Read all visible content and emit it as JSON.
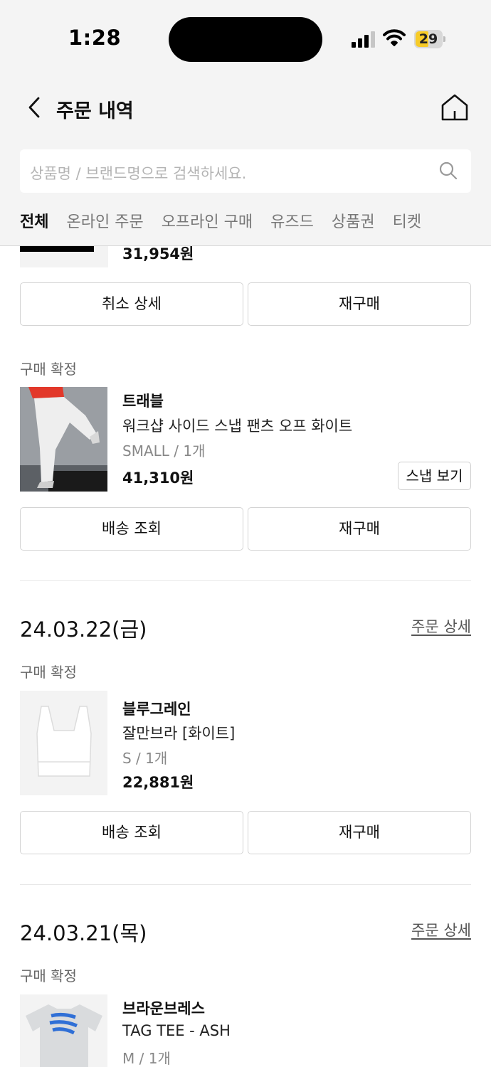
{
  "status_bar": {
    "time": "1:28",
    "battery": "29"
  },
  "header": {
    "title": "주문 내역"
  },
  "search": {
    "placeholder": "상품명 / 브랜드명으로 검색하세요."
  },
  "tabs": [
    {
      "label": "전체",
      "active": true
    },
    {
      "label": "온라인 주문",
      "active": false
    },
    {
      "label": "오프라인 구매",
      "active": false
    },
    {
      "label": "유즈드",
      "active": false
    },
    {
      "label": "상품권",
      "active": false
    },
    {
      "label": "티켓",
      "active": false
    }
  ],
  "partial_item": {
    "price": "31,954원",
    "buttons": [
      "취소 상세",
      "재구매"
    ]
  },
  "item_travel": {
    "status": "구매 확정",
    "brand": "트래블",
    "name": "워크샵 사이드 스냅 팬츠 오프 화이트",
    "option": "SMALL / 1개",
    "price": "41,310원",
    "snap_button": "스냅 보기",
    "buttons": [
      "배송 조회",
      "재구매"
    ]
  },
  "order_0322": {
    "date": "24.03.22(금)",
    "detail_link": "주문 상세",
    "status": "구매 확정",
    "brand": "블루그레인",
    "name": "잘만브라 [화이트]",
    "option": "S / 1개",
    "price": "22,881원",
    "buttons": [
      "배송 조회",
      "재구매"
    ]
  },
  "order_0321": {
    "date": "24.03.21(목)",
    "detail_link": "주문 상세",
    "status": "구매 확정",
    "brand": "브라운브레스",
    "name": "TAG TEE - ASH",
    "option": "M / 1개"
  },
  "colors": {
    "battery": "#f7cb27",
    "header_bg": "#f4f4f4"
  }
}
